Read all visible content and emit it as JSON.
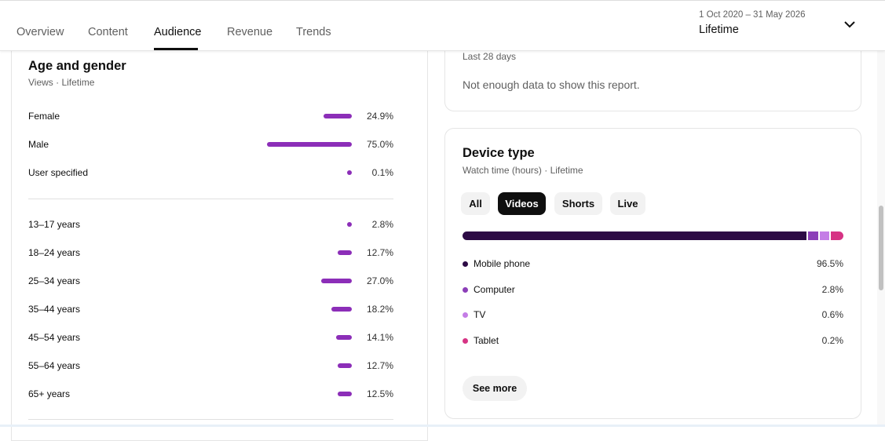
{
  "tabs": [
    {
      "label": "Overview"
    },
    {
      "label": "Content"
    },
    {
      "label": "Audience"
    },
    {
      "label": "Revenue"
    },
    {
      "label": "Trends"
    }
  ],
  "active_tab": "Audience",
  "date_picker": {
    "range": "1 Oct 2020 – 31 May 2026",
    "label": "Lifetime"
  },
  "age_gender": {
    "title": "Age and gender",
    "subtitle": "Views · Lifetime",
    "gender": [
      {
        "label": "Female",
        "pct": "24.9%",
        "value": 24.9
      },
      {
        "label": "Male",
        "pct": "75.0%",
        "value": 75.0
      },
      {
        "label": "User specified",
        "pct": "0.1%",
        "value": 0.1
      }
    ],
    "ages": [
      {
        "label": "13–17 years",
        "pct": "2.8%",
        "value": 2.8
      },
      {
        "label": "18–24 years",
        "pct": "12.7%",
        "value": 12.7
      },
      {
        "label": "25–34 years",
        "pct": "27.0%",
        "value": 27.0
      },
      {
        "label": "35–44 years",
        "pct": "18.2%",
        "value": 18.2
      },
      {
        "label": "45–54 years",
        "pct": "14.1%",
        "value": 14.1
      },
      {
        "label": "55–64 years",
        "pct": "12.7%",
        "value": 12.7
      },
      {
        "label": "65+ years",
        "pct": "12.5%",
        "value": 12.5
      }
    ]
  },
  "top_card": {
    "period": "Last 28 days",
    "message": "Not enough data to show this report."
  },
  "device_type": {
    "title": "Device type",
    "subtitle": "Watch time (hours) · Lifetime",
    "chips": [
      {
        "label": "All",
        "selected": false
      },
      {
        "label": "Videos",
        "selected": true
      },
      {
        "label": "Shorts",
        "selected": false
      },
      {
        "label": "Live",
        "selected": false
      }
    ],
    "devices": [
      {
        "name": "Mobile phone",
        "pct": "96.5%",
        "value": 96.5,
        "color": "#2d0b45"
      },
      {
        "name": "Computer",
        "pct": "2.8%",
        "value": 2.8,
        "color": "#8c3fb8"
      },
      {
        "name": "TV",
        "pct": "0.6%",
        "value": 0.6,
        "color": "#c47de6"
      },
      {
        "name": "Tablet",
        "pct": "0.2%",
        "value": 0.2,
        "color": "#d63384"
      }
    ],
    "see_more": "See more"
  },
  "colors": {
    "bar": "#8c2eb8",
    "chip_selected": "#0f0f0f"
  }
}
